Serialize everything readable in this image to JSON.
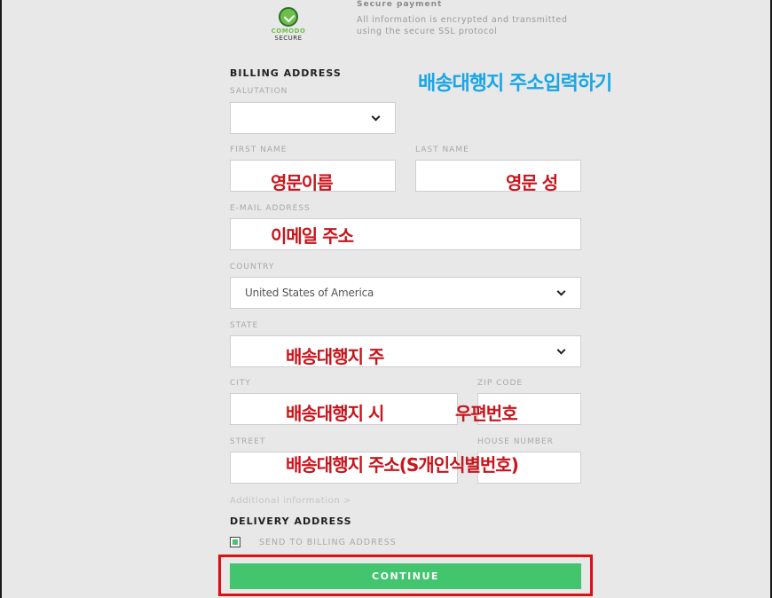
{
  "secure": {
    "brand_line1": "COMODO",
    "brand_line2": "SECURE",
    "title": "Secure payment",
    "description": "All information is encrypted and transmitted using the secure SSL protocol"
  },
  "billing": {
    "section_title": "BILLING ADDRESS",
    "salutation_label": "SALUTATION",
    "salutation_value": "",
    "first_name_label": "FIRST NAME",
    "last_name_label": "LAST NAME",
    "email_label": "E-MAIL ADDRESS",
    "country_label": "COUNTRY",
    "country_value": "United States of America",
    "state_label": "STATE",
    "city_label": "CITY",
    "zip_label": "ZIP CODE",
    "street_label": "STREET",
    "house_number_label": "HOUSE NUMBER",
    "additional_info": "Additional information  >"
  },
  "delivery": {
    "section_title": "DELIVERY ADDRESS",
    "send_to_billing_label": "SEND TO BILLING ADDRESS",
    "send_to_billing_checked": true
  },
  "continue_label": "CONTINUE",
  "annotations": {
    "heading": "배송대행지 주소입력하기",
    "first_name": "영문이름",
    "last_name": "영문 성",
    "email": "이메일 주소",
    "state": "배송대행지 주",
    "city": "배송대행지 시",
    "zip": "우편번호",
    "street": "배송대행지 주소(S개인식별번호)"
  },
  "colors": {
    "continue_green": "#43c46f",
    "annotation_red": "#c8141c",
    "annotation_blue": "#19a6e6",
    "highlight_red": "#e01010"
  }
}
